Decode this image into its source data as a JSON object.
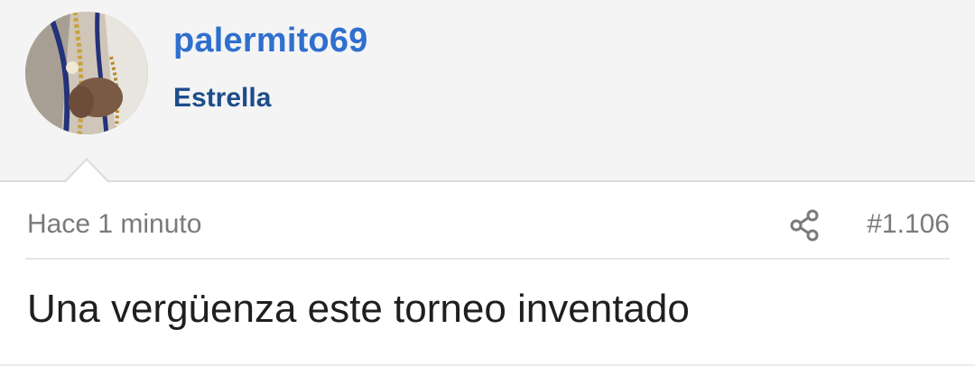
{
  "user": {
    "username": "palermito69",
    "title": "Estrella",
    "avatar_icon": "user-avatar-photo"
  },
  "post": {
    "timestamp": "Hace 1 minuto",
    "number": "#1.106",
    "share_icon": "share-icon",
    "body": "Una vergüenza este torneo inventado"
  },
  "colors": {
    "username": "#2f6fce",
    "title": "#1d4d8a",
    "header_bg": "#f4f4f5",
    "meta_text": "#7a7a7a",
    "body_text": "#1f1f1f"
  }
}
